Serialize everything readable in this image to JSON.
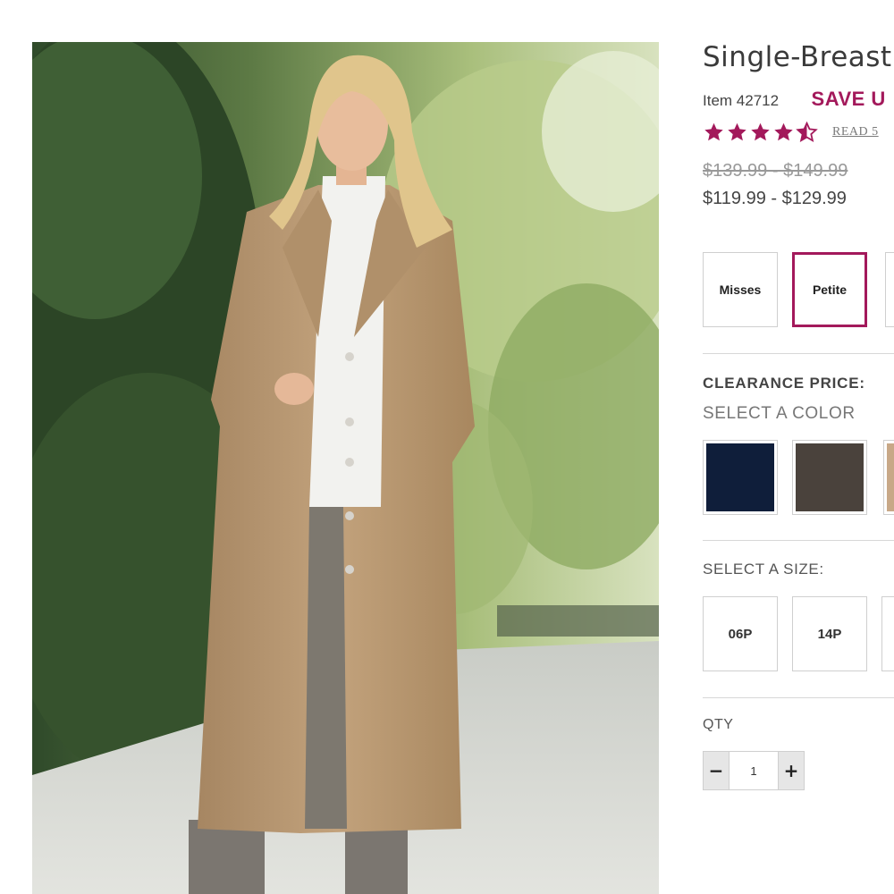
{
  "product": {
    "title": "Single-Breast",
    "item_number": "Item 42712",
    "save_text": "SAVE U",
    "rating": 4.5,
    "reviews_link": "READ 5",
    "price_original": "$139.99 - $149.99",
    "price_current": "$119.99 - $129.99"
  },
  "fit_options": [
    {
      "label": "Misses",
      "selected": false
    },
    {
      "label": "Petite",
      "selected": true
    }
  ],
  "clearance_label": "CLEARANCE PRICE:",
  "color_label": "SELECT A COLOR",
  "colors": [
    {
      "name": "navy",
      "hex": "#0f1e3a"
    },
    {
      "name": "brown",
      "hex": "#4a423c"
    },
    {
      "name": "camel",
      "hex": "#c8a887"
    }
  ],
  "size_label": "SELECT A SIZE:",
  "sizes": [
    "06P",
    "14P"
  ],
  "qty_label": "QTY",
  "qty_value": "1",
  "qty_minus": "−",
  "qty_plus": "+",
  "accent_color": "#a3195b",
  "star_color": "#a3195b",
  "icons": [
    "star-icon",
    "half-star-icon",
    "minus-icon",
    "plus-icon"
  ]
}
